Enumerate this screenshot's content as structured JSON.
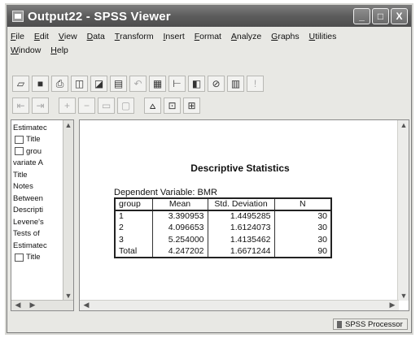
{
  "window": {
    "title": "Output22 - SPSS Viewer",
    "controls": [
      "_",
      "□",
      "X"
    ]
  },
  "menu": {
    "row1": [
      {
        "u": "F",
        "rest": "ile"
      },
      {
        "u": "E",
        "rest": "dit"
      },
      {
        "u": "V",
        "rest": "iew"
      },
      {
        "u": "D",
        "rest": "ata"
      },
      {
        "u": "T",
        "rest": "ransform"
      },
      {
        "u": "I",
        "rest": "nsert"
      },
      {
        "u": "F",
        "rest": "ormat",
        "pre": ""
      },
      {
        "u": "A",
        "rest": "nalyze"
      },
      {
        "u": "G",
        "rest": "raphs"
      },
      {
        "u": "U",
        "rest": "tilities"
      }
    ],
    "row2": [
      {
        "u": "W",
        "rest": "indow"
      },
      {
        "u": "H",
        "rest": "elp"
      }
    ]
  },
  "outline": {
    "items": [
      {
        "icon": "",
        "label": "Estimatec"
      },
      {
        "icon": "book",
        "label": "Title"
      },
      {
        "icon": "book",
        "label": "grou"
      },
      {
        "icon": "",
        "label": "variate A"
      },
      {
        "icon": "",
        "label": "Title"
      },
      {
        "icon": "",
        "label": "Notes"
      },
      {
        "icon": "",
        "label": "Between"
      },
      {
        "icon": "",
        "label": "Descripti"
      },
      {
        "icon": "",
        "label": "Levene's"
      },
      {
        "icon": "",
        "label": "Tests of"
      },
      {
        "icon": "",
        "label": "Estimatec"
      },
      {
        "icon": "book",
        "label": "Title"
      }
    ]
  },
  "output": {
    "table_title": "Descriptive Statistics",
    "dependent_variable": "Dependent Variable: BMR",
    "headers": [
      "group",
      "Mean",
      "Std. Deviation",
      "N"
    ],
    "rows": [
      [
        "1",
        "3.390953",
        "1.4495285",
        "30"
      ],
      [
        "2",
        "4.096653",
        "1.6124073",
        "30"
      ],
      [
        "3",
        "5.254000",
        "1.4135462",
        "30"
      ],
      [
        "Total",
        "4.247202",
        "1.6671244",
        "90"
      ]
    ]
  },
  "status": {
    "processor": "SPSS Processor"
  }
}
